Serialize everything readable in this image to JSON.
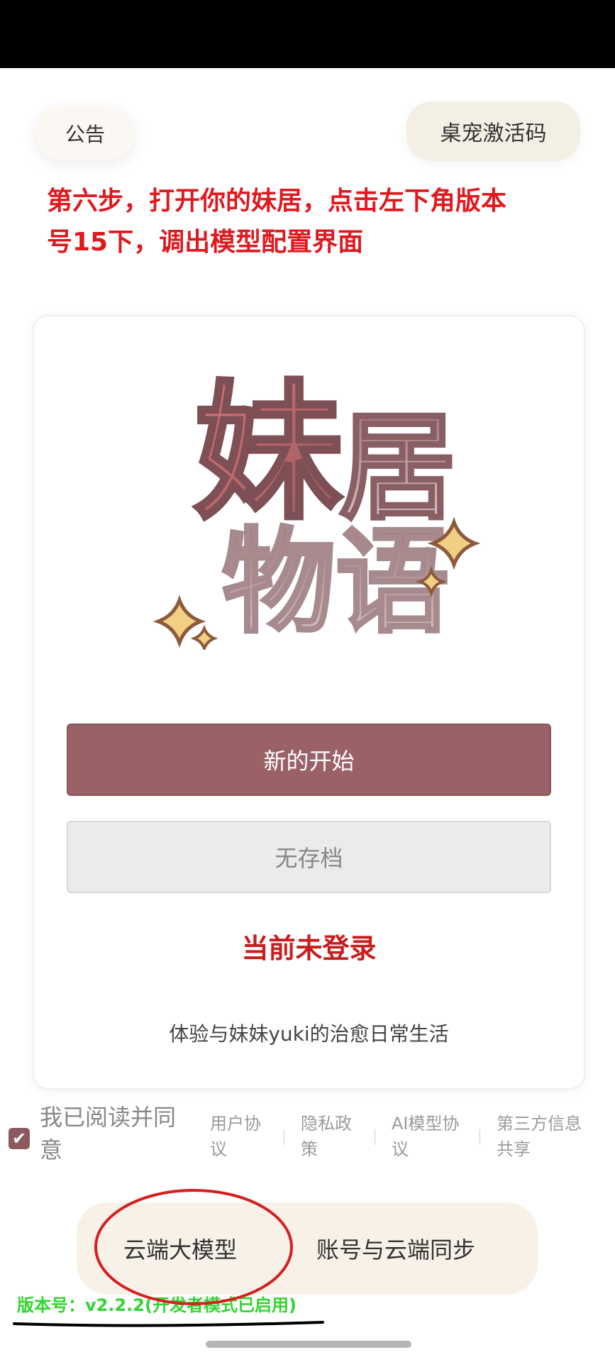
{
  "top": {
    "notice_label": "公告",
    "activation_label": "桌宠激活码"
  },
  "instruction": {
    "line1": "第六步，打开你的妹居，点击左下角版本",
    "line2": "号15下，调出模型配置界面"
  },
  "card": {
    "logo": {
      "line1_char1": "妹",
      "line1_char2": "居",
      "line2": "物语"
    },
    "new_game_label": "新的开始",
    "no_save_label": "无存档",
    "login_status": "当前未登录",
    "tagline": "体验与妹妹yuki的治愈日常生活"
  },
  "agreement": {
    "text": "我已阅读并同意",
    "links": [
      "用户协议",
      "隐私政策",
      "AI模型协议",
      "第三方信息共享"
    ],
    "checked": true
  },
  "bottom": {
    "cloud_model_label": "云端大模型",
    "account_sync_label": "账号与云端同步"
  },
  "version_text": "版本号：v2.2.2(开发者模式已启用)",
  "colors": {
    "accent": "#9a6266",
    "instruction_red": "#e0191f",
    "version_green": "#2fd62f"
  }
}
